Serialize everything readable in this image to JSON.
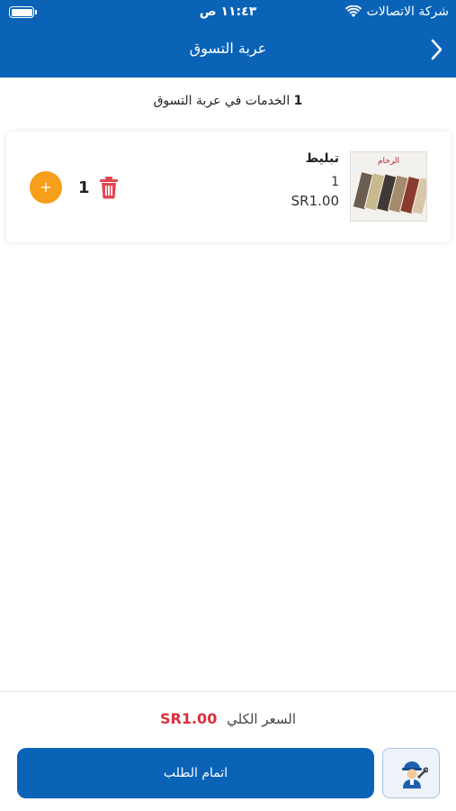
{
  "status_bar": {
    "time": "١١:٤٣ ص",
    "carrier": "شركة الاتصالات"
  },
  "nav": {
    "title": "عربة التسوق",
    "back_icon": "chevron-right-icon"
  },
  "summary": {
    "count": "1",
    "text": "الخدمات في عربة التسوق"
  },
  "cart_items": [
    {
      "name": "تبليط",
      "quantity": "1",
      "price": "SR1.00",
      "image_caption": "الرخام",
      "stepper_value": "1",
      "plus_label": "+"
    }
  ],
  "footer": {
    "total_label": "السعر الكلي",
    "total_value": "SR1.00",
    "checkout_label": "اتمام الطلب",
    "tech_icon": "technician-icon"
  },
  "colors": {
    "primary": "#0a63b7",
    "accent_orange": "#f79e1b",
    "delete_red": "#e64551",
    "total_red": "#d9303a"
  }
}
